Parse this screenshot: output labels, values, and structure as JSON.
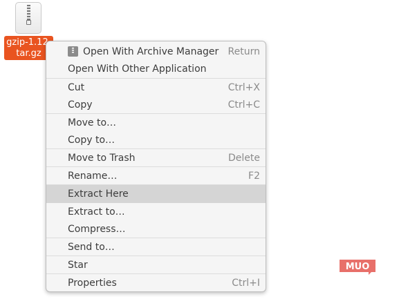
{
  "desktop_file": {
    "name_line1": "gzip-1.12.",
    "name_line2": "tar.gz",
    "icon": "archive-zip-icon"
  },
  "context_menu": {
    "items": [
      {
        "label": "Open With Archive Manager",
        "accel": "Return",
        "icon": "archive-manager-icon"
      },
      {
        "label": "Open With Other Application",
        "accel": ""
      },
      {
        "label": "Cut",
        "accel": "Ctrl+X"
      },
      {
        "label": "Copy",
        "accel": "Ctrl+C"
      },
      {
        "label": "Move to…",
        "accel": ""
      },
      {
        "label": "Copy to…",
        "accel": ""
      },
      {
        "label": "Move to Trash",
        "accel": "Delete"
      },
      {
        "label": "Rename…",
        "accel": "F2"
      },
      {
        "label": "Extract Here",
        "accel": "",
        "highlighted": true
      },
      {
        "label": "Extract to…",
        "accel": ""
      },
      {
        "label": "Compress…",
        "accel": ""
      },
      {
        "label": "Send to…",
        "accel": ""
      },
      {
        "label": "Star",
        "accel": ""
      },
      {
        "label": "Properties",
        "accel": "Ctrl+I"
      }
    ]
  },
  "watermark": {
    "text": "MUO",
    "color": "#e8706a"
  },
  "colors": {
    "selection": "#e95420",
    "menu_bg": "#f5f5f5",
    "highlight": "#d5d5d5"
  }
}
